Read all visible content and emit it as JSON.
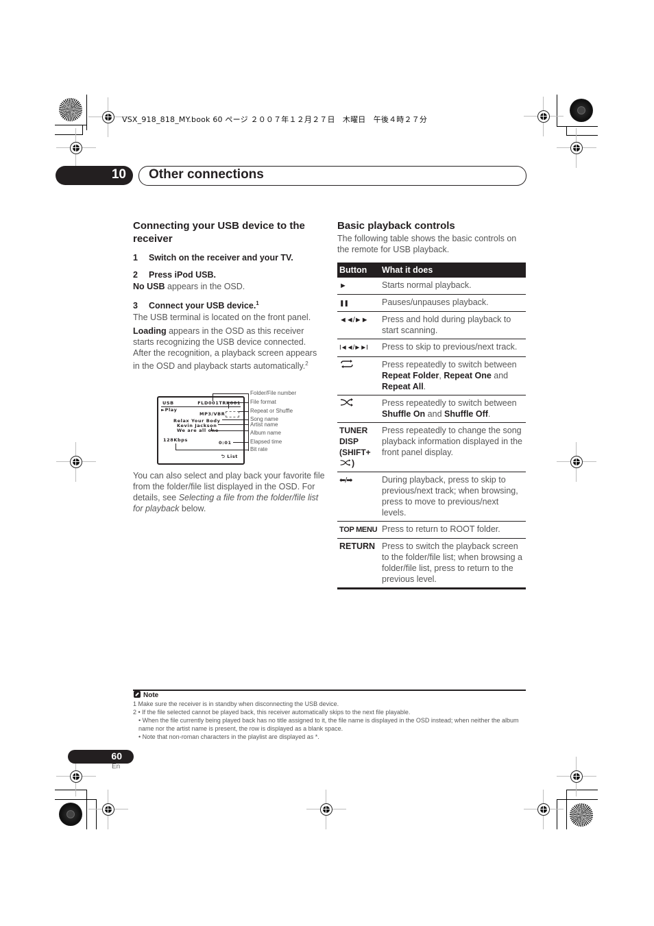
{
  "print_header": {
    "book_info": "VSX_918_818_MY.book 60 ページ ２００７年１２月２７日　木曜日　午後４時２７分"
  },
  "chapter": {
    "number": "10",
    "title": "Other connections"
  },
  "left_column": {
    "heading": "Connecting your USB device to the receiver",
    "steps": [
      {
        "num": "1",
        "text": "Switch on the receiver and your TV."
      },
      {
        "num": "2",
        "text": "Press iPod USB."
      },
      {
        "num": "3",
        "text": "Connect your USB device.",
        "footnote_ref": "1"
      }
    ],
    "step2_result_bold": "No USB",
    "step2_result_rest": " appears in the OSD.",
    "step3_p1": "The USB terminal is located on the front panel.",
    "step3_p2_bold": "Loading",
    "step3_p2_rest": " appears in the OSD as this receiver starts recognizing the USB device connected. After the recognition, a playback screen appears in the OSD and playback starts automatically.",
    "step3_p2_footnote": "2",
    "closing_p_start": "You can also select and play back your favorite file from the folder/file list displayed in the OSD. For details, see ",
    "closing_p_italic": "Selecting a file from the folder/file list for playback",
    "closing_p_end": " below."
  },
  "osd_diagram": {
    "screen": {
      "source": "USB",
      "file_number": "FLD001TRK001",
      "status": "►Play",
      "format": "MP3/VBR",
      "song": "Relax Your Body",
      "artist": "Kevin Jackson",
      "album": "We are all one",
      "bitrate": "128Kbps",
      "elapsed": "0:01",
      "list_label": "⮌ List"
    },
    "labels": {
      "folder_file_number": "Folder/File number",
      "file_format": "File format",
      "repeat_shuffle": "Repeat or Shuffle",
      "song_name": "Song name",
      "artist_name": "Artist name",
      "album_name": "Album name",
      "elapsed_time": "Elapsed time",
      "bit_rate": "Bit rate"
    }
  },
  "right_column": {
    "heading": "Basic playback controls",
    "intro": "The following table shows the basic controls on the remote for USB playback.",
    "table": {
      "headers": [
        "Button",
        "What it does"
      ],
      "rows": [
        {
          "button": "►",
          "desc": "Starts normal playback."
        },
        {
          "button": "❚❚",
          "desc": "Pauses/unpauses playback."
        },
        {
          "button": "◄◄/►►",
          "desc": "Press and hold during playback to start scanning."
        },
        {
          "button": "I◄◄/►►I",
          "desc": "Press to skip to previous/next track."
        },
        {
          "button": "repeat-icon",
          "desc_start": "Press repeatedly to switch between ",
          "b1": "Repeat Folder",
          "sep1": ", ",
          "b2": "Repeat One",
          "sep2": " and ",
          "b3": "Repeat All",
          "end": "."
        },
        {
          "button": "shuffle-icon",
          "desc_start": "Press repeatedly to switch between ",
          "b1": "Shuffle On",
          "sep1": " and ",
          "b2": "Shuffle Off",
          "end": "."
        },
        {
          "button": "TUNER DISP (SHIFT+",
          "button_end": ")",
          "desc": "Press repeatedly to change the song playback information displayed in the front panel display."
        },
        {
          "button": "⬅/➡",
          "desc": "During playback, press to skip to previous/next track; when browsing, press to move to previous/next levels."
        },
        {
          "button": "TOP MENU",
          "desc": "Press to return to ROOT folder."
        },
        {
          "button": "RETURN",
          "desc": "Press to switch the playback screen to the folder/file list; when browsing a folder/file list, press to return to the previous level."
        }
      ]
    }
  },
  "notes": {
    "title": "Note",
    "items": [
      "1 Make sure the receiver is in standby when disconnecting the USB device.",
      "2 • If the file selected cannot be played back, this receiver automatically skips to the next file playable.",
      "   • When the file currently being played back has no title assigned to it, the file name is displayed in the OSD instead; when neither the album name nor the artist name is present, the row is displayed as a blank space.",
      "   • Note that non-roman characters in the playlist are displayed as *."
    ]
  },
  "footer": {
    "page_number": "60",
    "language": "En"
  }
}
